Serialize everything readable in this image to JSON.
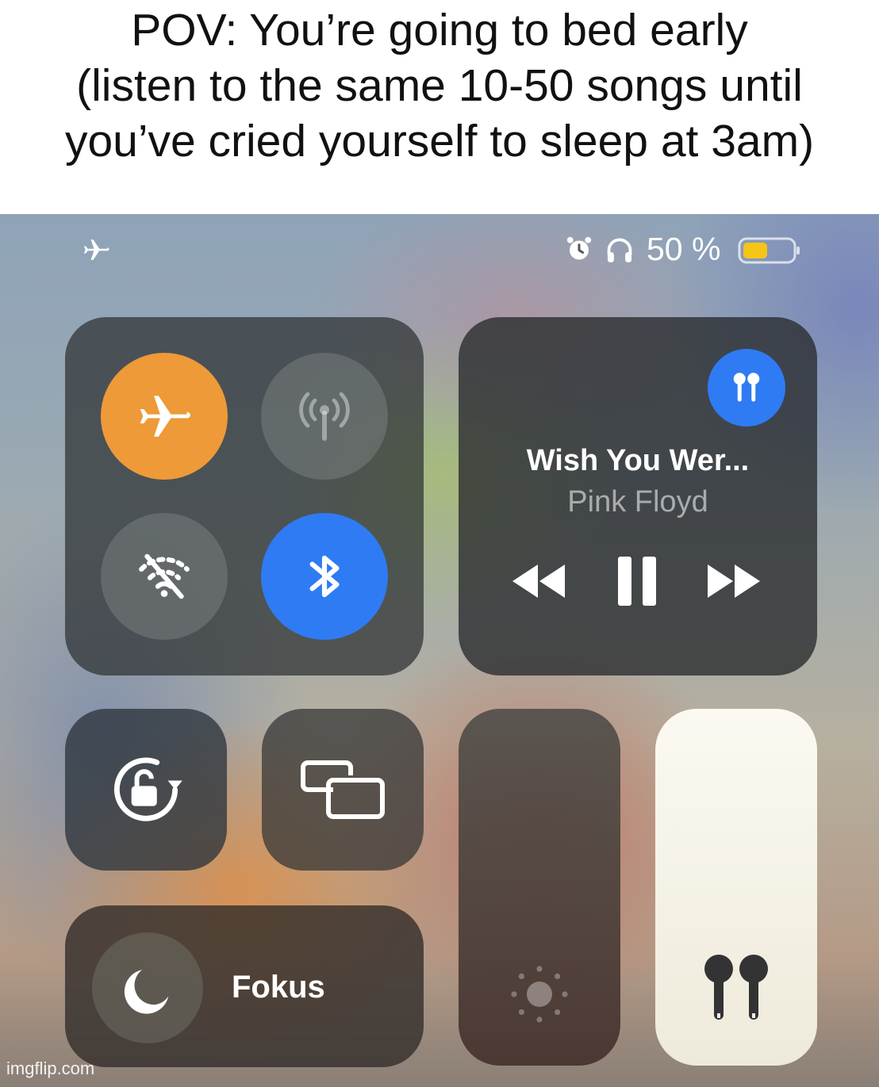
{
  "caption": {
    "line1": "POV: You’re going to bed early",
    "line2": "(listen to the same 10-50 songs until",
    "line3": "you’ve cried yourself to sleep at 3am)"
  },
  "status_bar": {
    "left_icon": "airplane-icon",
    "icons": [
      "alarm-icon",
      "headphones-icon"
    ],
    "battery_percent_text": "50 %",
    "battery_level": 0.5,
    "battery_color": "#f5c518"
  },
  "connectivity": {
    "airplane_mode": {
      "on": true,
      "color": "#ee9a38"
    },
    "cellular_data": {
      "on": false
    },
    "wifi": {
      "on": false
    },
    "bluetooth": {
      "on": true,
      "color": "#2f7bf3"
    }
  },
  "now_playing": {
    "title": "Wish You Wer...",
    "artist": "Pink Floyd",
    "state": "playing",
    "output_device_icon": "airpods-icon"
  },
  "tiles": {
    "rotation_lock": "rotation-lock-icon",
    "screen_mirroring": "screen-mirroring-icon",
    "focus_label": "Fokus",
    "focus_icon": "moon-icon",
    "brightness_level": 0.0,
    "volume_level": 1.0
  },
  "watermark": "imgflip.com"
}
